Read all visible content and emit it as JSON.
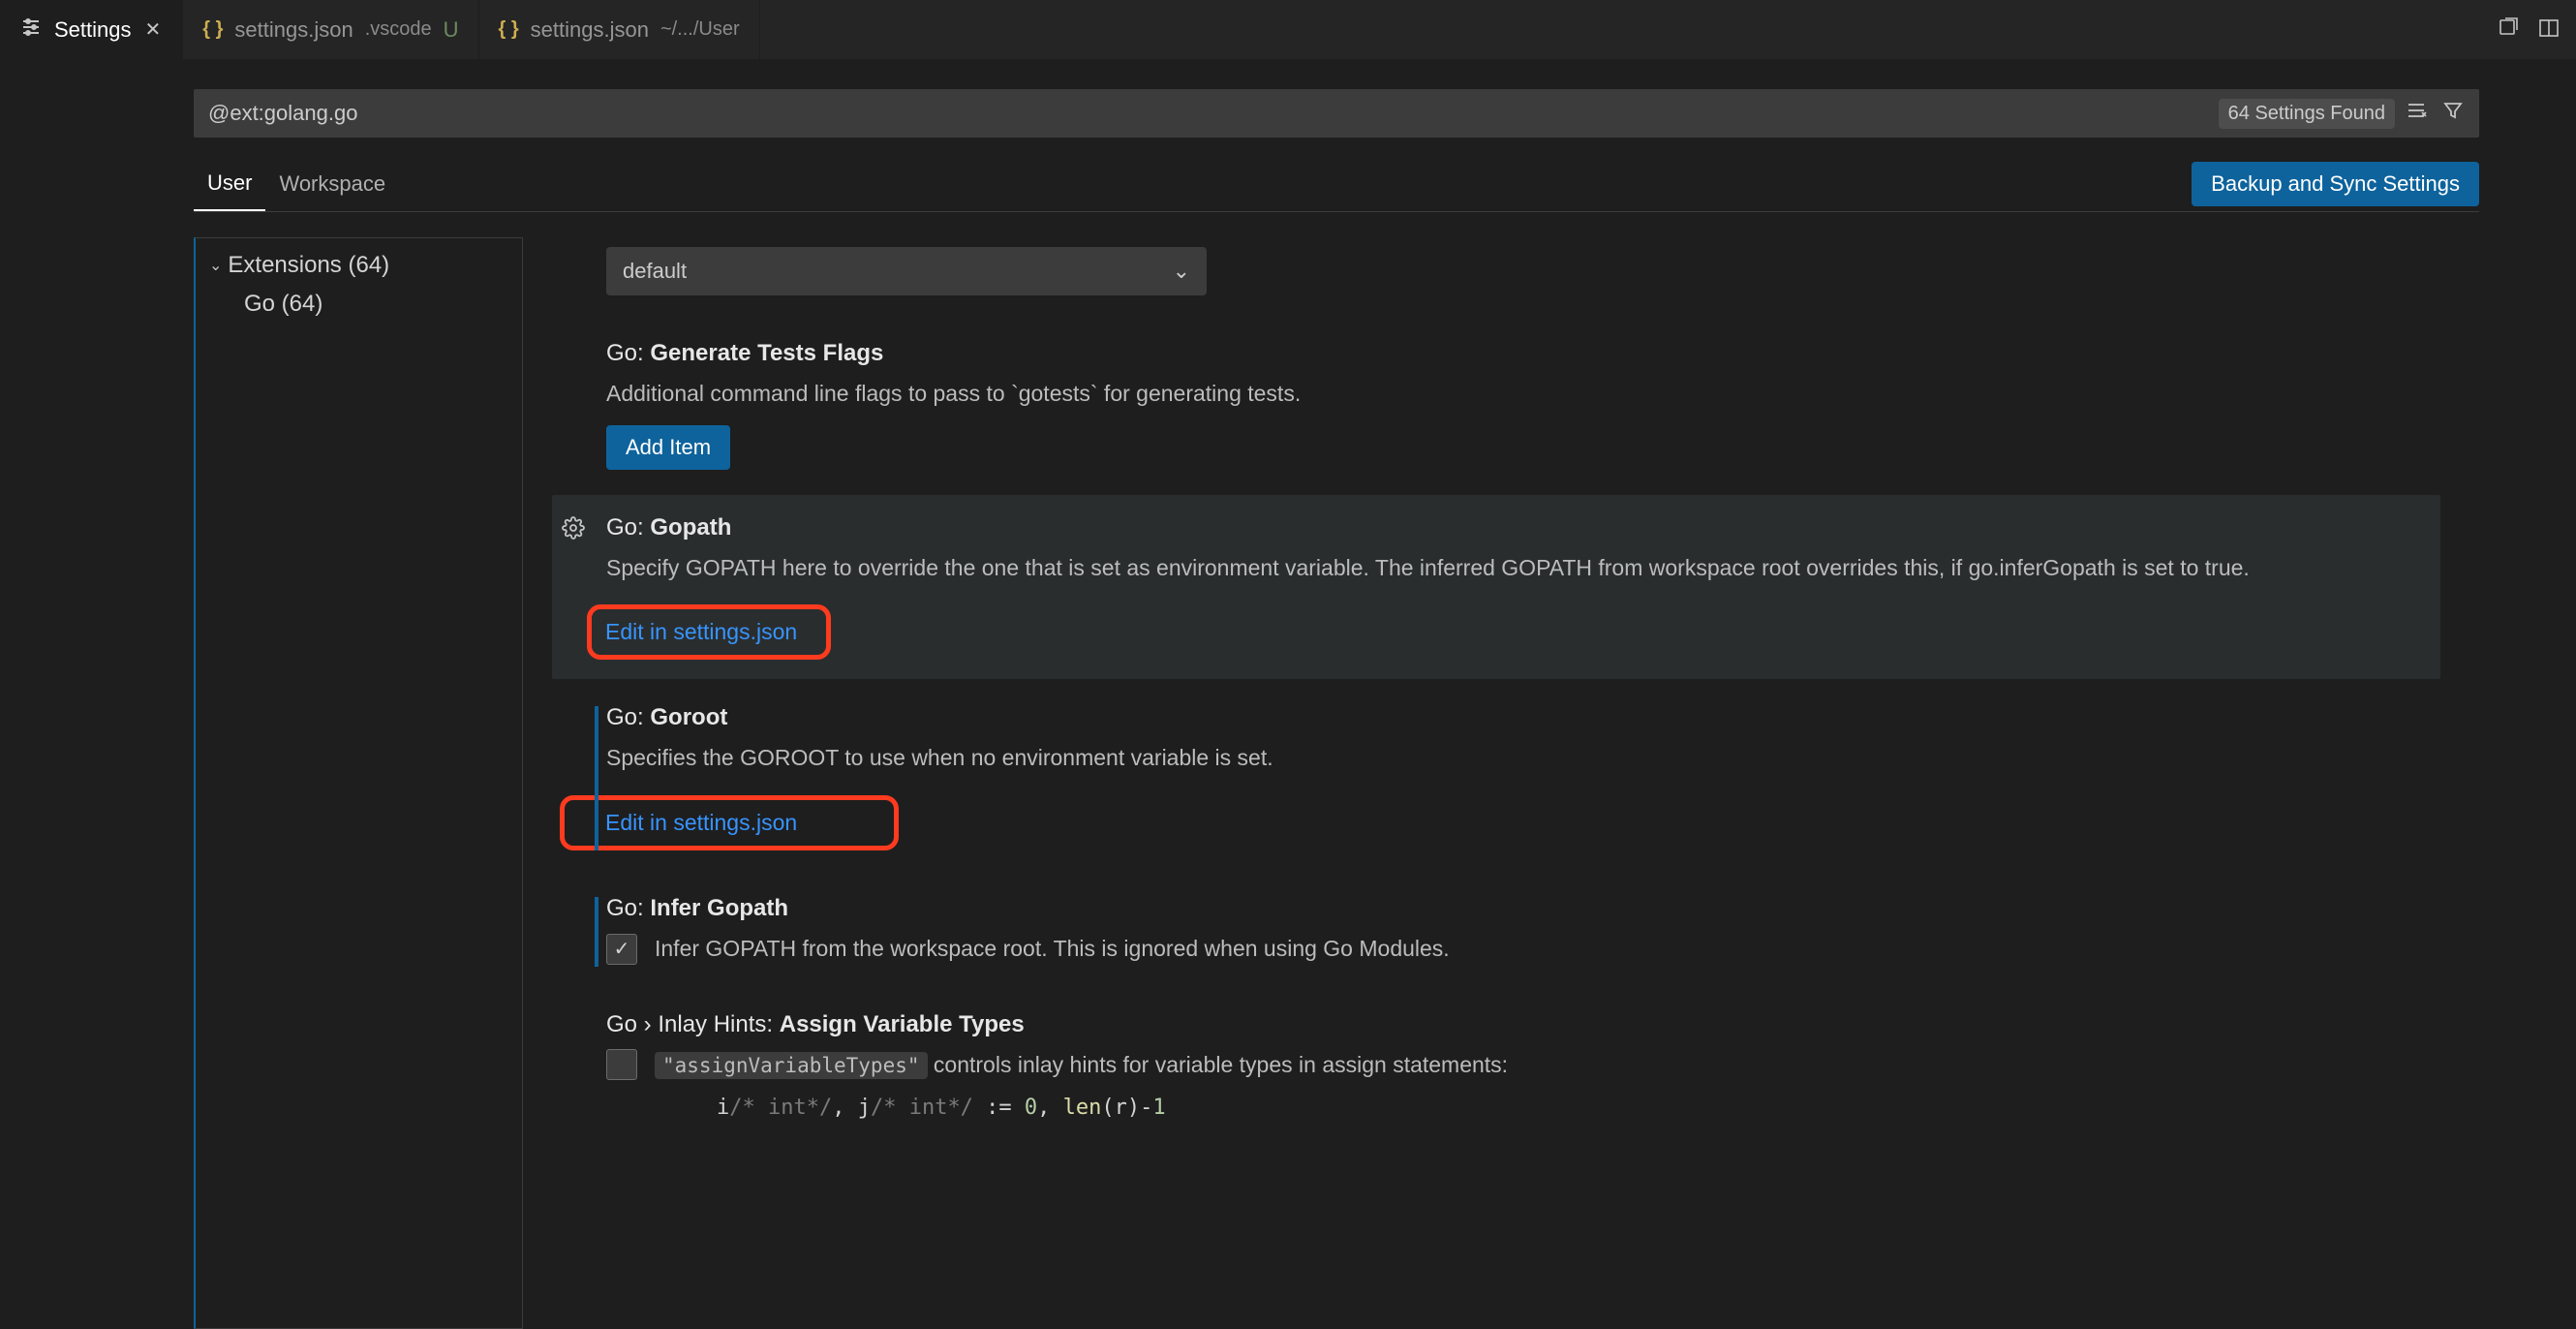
{
  "tabs": {
    "settings": "Settings",
    "json_vscode": {
      "name": "settings.json",
      "desc": ".vscode",
      "modified": "U"
    },
    "json_user": {
      "name": "settings.json",
      "desc": "~/.../User"
    }
  },
  "search": {
    "value": "@ext:golang.go",
    "found": "64 Settings Found"
  },
  "scope": {
    "user": "User",
    "workspace": "Workspace"
  },
  "backup_button": "Backup and Sync Settings",
  "sidebar": {
    "extensions": "Extensions (64)",
    "go": "Go (64)"
  },
  "dropdown_value": "default",
  "setting_generate_tests": {
    "prefix": "Go:",
    "name": "Generate Tests Flags",
    "desc": "Additional command line flags to pass to `gotests` for generating tests.",
    "button": "Add Item"
  },
  "setting_gopath": {
    "prefix": "Go:",
    "name": "Gopath",
    "desc": "Specify GOPATH here to override the one that is set as environment variable. The inferred GOPATH from workspace root overrides this, if go.inferGopath is set to true.",
    "link": "Edit in settings.json"
  },
  "setting_goroot": {
    "prefix": "Go:",
    "name": "Goroot",
    "desc": "Specifies the GOROOT to use when no environment variable is set.",
    "link": "Edit in settings.json"
  },
  "setting_infer": {
    "prefix": "Go:",
    "name": "Infer Gopath",
    "desc": "Infer GOPATH from the workspace root. This is ignored when using Go Modules."
  },
  "setting_inlay": {
    "prefix": "Go › Inlay Hints:",
    "name": "Assign Variable Types",
    "code_term": "\"assignVariableTypes\"",
    "desc_tail": " controls inlay hints for variable types in assign statements:",
    "code_line": {
      "p1": "i",
      "h1": "/* int*/",
      "p2": ", j",
      "h2": "/* int*/",
      "p3": " := ",
      "n1": "0",
      "p4": ", ",
      "kw": "len",
      "p5": "(r)-",
      "n2": "1"
    }
  }
}
